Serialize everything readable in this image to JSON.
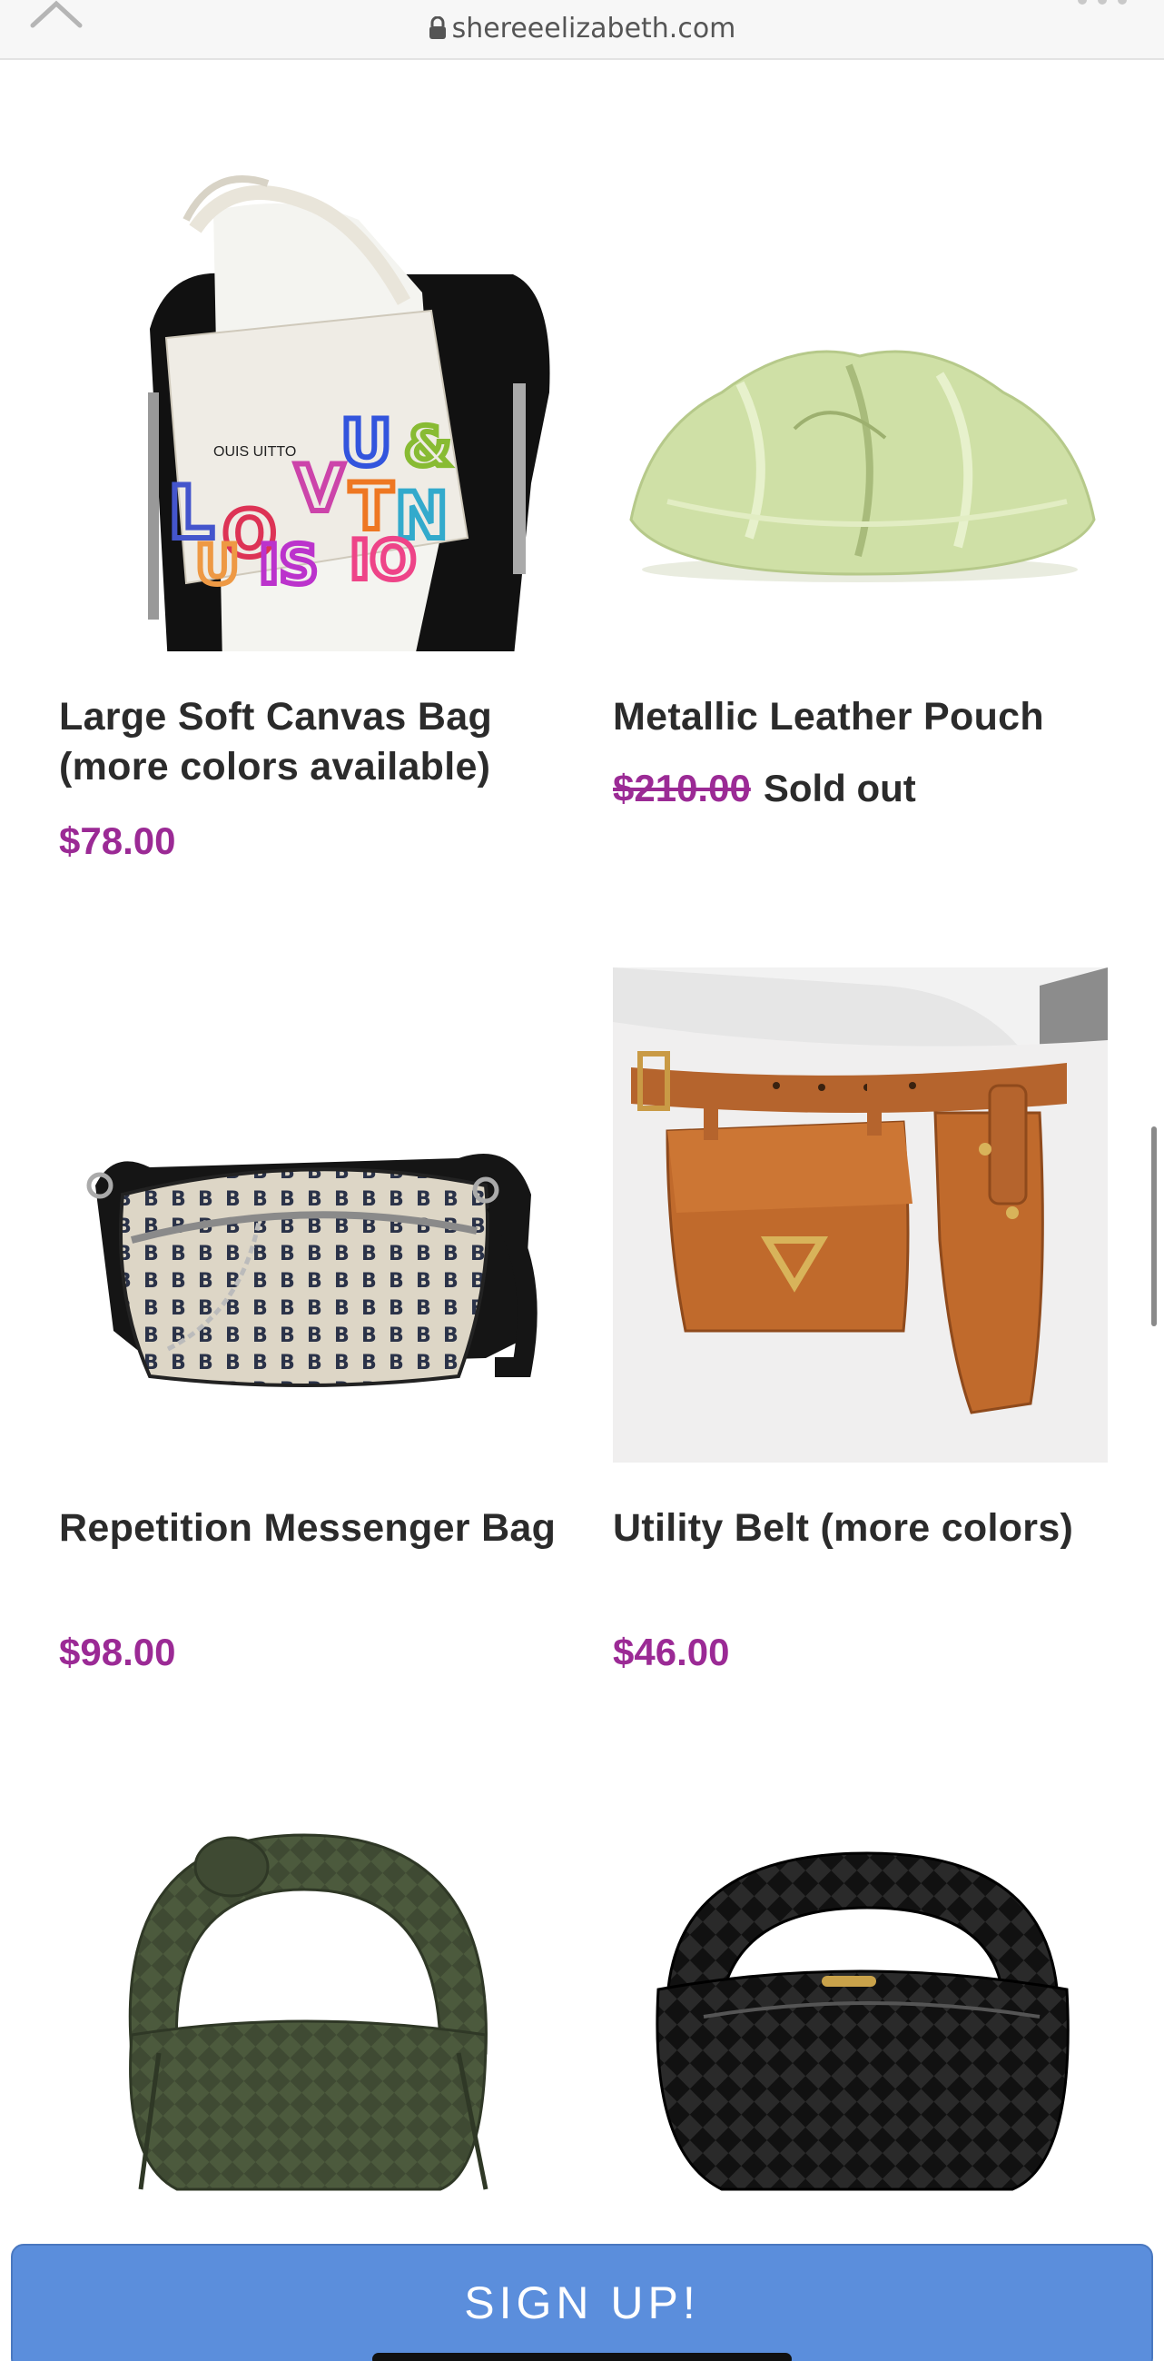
{
  "browser": {
    "url": "shereeelizabeth.com"
  },
  "products": [
    {
      "name": "Large Soft Canvas Bag (more colors available)",
      "price": "$78.00",
      "compare_price": "",
      "status": ""
    },
    {
      "name": "Metallic Leather Pouch",
      "price": "",
      "compare_price": "$210.00",
      "status": "Sold out"
    },
    {
      "name": "Repetition Messenger Bag",
      "price": "$98.00",
      "compare_price": "",
      "status": ""
    },
    {
      "name": "Utility Belt (more colors)",
      "price": "$46.00",
      "compare_price": "",
      "status": ""
    }
  ],
  "bag_print": {
    "brand": "OUIS UITTO"
  },
  "signup": {
    "label": "SIGN UP!"
  },
  "colors": {
    "price": "#9b2a95",
    "signup_bg": "#5b8edc"
  },
  "icons": [
    "chevron-up-icon",
    "lock-icon",
    "more-icon"
  ]
}
